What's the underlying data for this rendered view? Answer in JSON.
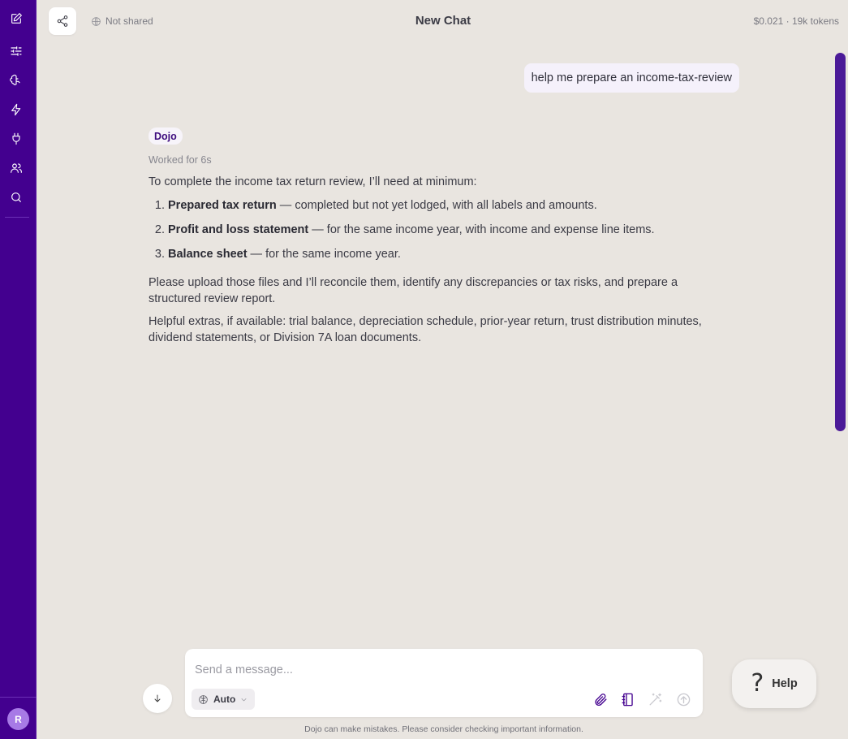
{
  "sidebar": {
    "items": [
      {
        "name": "new-chat",
        "icon": "edit-icon"
      },
      {
        "name": "settings",
        "icon": "sliders-icon"
      },
      {
        "name": "agents",
        "icon": "brain-icon"
      },
      {
        "name": "automations",
        "icon": "lightning-icon"
      },
      {
        "name": "integrations",
        "icon": "plug-icon"
      },
      {
        "name": "team",
        "icon": "users-icon"
      },
      {
        "name": "search",
        "icon": "search-icon"
      }
    ],
    "avatar_initial": "R",
    "accent": "#43008f"
  },
  "header": {
    "share_status": "Not shared",
    "title": "New Chat",
    "usage": "$0.021 · 19k tokens"
  },
  "conversation": {
    "user_message": "help me prepare an income-tax-review",
    "agent_name": "Dojo",
    "worked_for": "Worked for 6s",
    "intro": "To complete the income tax return review, I’ll need at minimum:",
    "requirements": [
      {
        "title": "Prepared tax return",
        "detail": " — completed but not yet lodged, with all labels and amounts."
      },
      {
        "title": "Profit and loss statement",
        "detail": " — for the same income year, with income and expense line items."
      },
      {
        "title": "Balance sheet",
        "detail": " — for the same income year."
      }
    ],
    "paragraph_1": "Please upload those files and I’ll reconcile them, identify any discrepancies or tax risks, and prepare a structured review report.",
    "paragraph_2": "Helpful extras, if available: trial balance, depreciation schedule, prior-year return, trust distribution minutes, dividend statements, or Division 7A loan documents."
  },
  "composer": {
    "placeholder": "Send a message...",
    "value": "",
    "model": "Auto"
  },
  "disclaimer": "Dojo can make mistakes. Please consider checking important information.",
  "help": {
    "label": "Help",
    "icon": "?"
  }
}
